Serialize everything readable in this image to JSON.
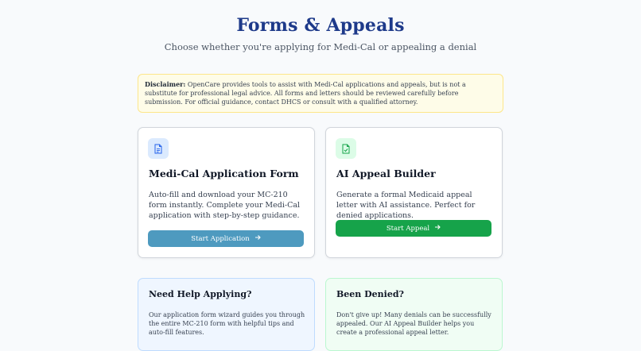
{
  "header": {
    "title": "Forms & Appeals",
    "subtitle": "Choose whether you're applying for Medi-Cal or appealing a denial"
  },
  "disclaimer": {
    "label": "Disclaimer:",
    "text": "OpenCare provides tools to assist with Medi-Cal applications and appeals, but is not a substitute for professional legal advice. All forms and letters should be reviewed carefully before submission. For official guidance, contact DHCS or consult with a qualified attorney."
  },
  "cards": {
    "application": {
      "icon": "document-icon",
      "title": "Medi-Cal Application Form",
      "description": "Auto-fill and download your MC-210 form instantly. Complete your Medi-Cal application with step-by-step guidance.",
      "button_label": "Start Application",
      "button_color": "#4e9abf"
    },
    "appeal": {
      "icon": "document-check-icon",
      "title": "AI Appeal Builder",
      "description": "Generate a formal Medicaid appeal letter with AI assistance. Perfect for denied applications.",
      "button_label": "Start Appeal",
      "button_color": "#16a34a"
    }
  },
  "help": {
    "applying": {
      "title": "Need Help Applying?",
      "text": "Our application form wizard guides you through the entire MC-210 form with helpful tips and auto-fill features."
    },
    "denied": {
      "title": "Been Denied?",
      "text": "Don't give up! Many denials can be successfully appealed. Our AI Appeal Builder helps you create a professional appeal letter."
    }
  }
}
